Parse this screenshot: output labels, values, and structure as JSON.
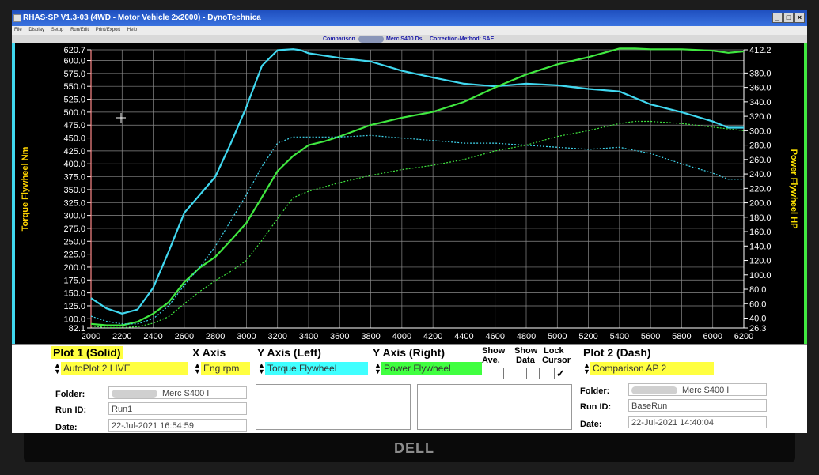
{
  "window": {
    "title": "RHAS-SP V1.3-03  (4WD - Motor Vehicle 2x2000) - DynoTechnica",
    "menu": [
      "File",
      "Display",
      "Setup",
      "Run/Edit",
      "Print/Export",
      "Help"
    ],
    "buttons": {
      "minimize": "_",
      "maximize": "□",
      "close": "×"
    }
  },
  "info_strip": {
    "comparison_label": "Comparison",
    "vehicle": "Merc S400 Ds",
    "correction": "Correction-Method: SAE"
  },
  "colors": {
    "plot_bg": "#000000",
    "grid": "#8a8a8a",
    "torque": "#40d8f0",
    "power": "#40e840",
    "left_axis_label": "#ffd400",
    "right_axis_label": "#ffe400",
    "highlight_yellow": "#ffff40",
    "highlight_cyan": "#40ffff",
    "highlight_green": "#40ff40"
  },
  "chart_data": {
    "type": "line",
    "xlabel": "",
    "ylabel_left": "Torque Flywheel Nm",
    "ylabel_right": "Power Flywheel HP",
    "x_range": [
      2000,
      6200
    ],
    "y_left_range": [
      82.1,
      620.7
    ],
    "y_right_range": [
      26.3,
      412.2
    ],
    "x_ticks": [
      "2000",
      "2200",
      "2400",
      "2600",
      "2800",
      "3000",
      "3200",
      "3400",
      "3600",
      "3800",
      "4000",
      "4200",
      "4400",
      "4600",
      "4800",
      "5000",
      "5200",
      "5400",
      "5600",
      "5800",
      "6000",
      "6200"
    ],
    "y_left_ticks": [
      "620.7",
      "600.0",
      "575.0",
      "550.0",
      "525.0",
      "500.0",
      "475.0",
      "450.0",
      "425.0",
      "400.0",
      "375.0",
      "350.0",
      "325.0",
      "300.0",
      "275.0",
      "250.0",
      "225.0",
      "200.0",
      "175.0",
      "150.0",
      "125.0",
      "100.0",
      "82.1"
    ],
    "y_right_ticks": [
      "412.2",
      "380.0",
      "360.0",
      "340.0",
      "320.0",
      "300.0",
      "280.0",
      "260.0",
      "240.0",
      "220.0",
      "200.0",
      "180.0",
      "160.0",
      "140.0",
      "120.0",
      "100.0",
      "80.0",
      "60.0",
      "40.0",
      "26.3"
    ],
    "grid": true,
    "series": [
      {
        "name": "Torque Flywheel",
        "axis": "left",
        "style": "solid",
        "color": "#40d8f0",
        "x": [
          2000,
          2100,
          2200,
          2300,
          2400,
          2500,
          2600,
          2700,
          2800,
          2900,
          3000,
          3100,
          3200,
          3300,
          3350,
          3400,
          3600,
          3800,
          4000,
          4200,
          4400,
          4600,
          4800,
          5000,
          5200,
          5400,
          5600,
          5800,
          6000,
          6100,
          6200
        ],
        "y": [
          140,
          120,
          110,
          118,
          160,
          230,
          305,
          340,
          375,
          440,
          510,
          590,
          620,
          622,
          620,
          614,
          605,
          598,
          580,
          567,
          555,
          550,
          555,
          552,
          545,
          540,
          515,
          500,
          482,
          470,
          470
        ]
      },
      {
        "name": "Power Flywheel",
        "axis": "right",
        "style": "solid",
        "color": "#40e840",
        "x": [
          2000,
          2100,
          2200,
          2300,
          2400,
          2500,
          2600,
          2700,
          2800,
          2900,
          3000,
          3100,
          3200,
          3300,
          3400,
          3500,
          3600,
          3800,
          4000,
          4200,
          4400,
          4600,
          4800,
          5000,
          5200,
          5400,
          5500,
          5600,
          5800,
          6000,
          6100,
          6200
        ],
        "y": [
          32,
          30,
          30,
          35,
          46,
          62,
          90,
          110,
          125,
          148,
          172,
          208,
          244,
          265,
          280,
          285,
          292,
          308,
          318,
          326,
          340,
          360,
          378,
          392,
          402,
          414,
          414,
          413,
          413,
          411,
          408,
          410
        ]
      },
      {
        "name": "Torque Flywheel",
        "axis": "left",
        "style": "dash",
        "color": "#40d8f0",
        "x": [
          2000,
          2100,
          2200,
          2300,
          2400,
          2500,
          2600,
          2700,
          2800,
          2900,
          3000,
          3100,
          3200,
          3300,
          3400,
          3600,
          3800,
          4000,
          4200,
          4400,
          4600,
          4800,
          5000,
          5200,
          5400,
          5600,
          5800,
          6000,
          6100,
          6200
        ],
        "y": [
          105,
          95,
          90,
          90,
          100,
          125,
          165,
          200,
          240,
          290,
          340,
          395,
          440,
          452,
          452,
          452,
          455,
          450,
          445,
          440,
          440,
          436,
          432,
          428,
          432,
          420,
          400,
          382,
          370,
          370
        ]
      },
      {
        "name": "Power Flywheel",
        "axis": "right",
        "style": "dash",
        "color": "#40e840",
        "x": [
          2000,
          2100,
          2200,
          2300,
          2400,
          2500,
          2600,
          2700,
          2800,
          2900,
          3000,
          3100,
          3200,
          3300,
          3400,
          3600,
          3800,
          4000,
          4200,
          4400,
          4600,
          4800,
          5000,
          5200,
          5400,
          5500,
          5600,
          5800,
          6000,
          6200
        ],
        "y": [
          29,
          27,
          27,
          28,
          33,
          42,
          60,
          77,
          92,
          105,
          120,
          148,
          178,
          207,
          216,
          228,
          238,
          246,
          252,
          260,
          272,
          280,
          292,
          300,
          310,
          313,
          313,
          310,
          305,
          300
        ]
      }
    ]
  },
  "controls": {
    "plot1": {
      "header": "Plot 1 (Solid)",
      "value": "AutoPlot 2 LIVE",
      "folder_label": "Folder:",
      "folder_value": "Merc S400 I",
      "runid_label": "Run ID:",
      "runid_value": "Run1",
      "date_label": "Date:",
      "date_value": "22-Jul-2021   16:54:59"
    },
    "xaxis": {
      "header": "X Axis",
      "value": "Eng rpm"
    },
    "yaxis_left": {
      "header": "Y Axis (Left)",
      "value": "Torque Flywheel"
    },
    "yaxis_right": {
      "header": "Y Axis (Right)",
      "value": "Power Flywheel"
    },
    "show_ave": {
      "label_top": "Show",
      "label_bottom": "Ave."
    },
    "show_data": {
      "label_top": "Show",
      "label_bottom": "Data"
    },
    "lock_cursor": {
      "label_top": "Lock",
      "label_bottom": "Cursor",
      "checked_mark": "✓"
    },
    "plot2": {
      "header": "Plot 2 (Dash)",
      "value": "Comparison AP 2",
      "folder_label": "Folder:",
      "folder_value": "Merc S400 I",
      "runid_label": "Run ID:",
      "runid_value": "BaseRun",
      "date_label": "Date:",
      "date_value": "22-Jul-2021   14:40:04"
    }
  }
}
